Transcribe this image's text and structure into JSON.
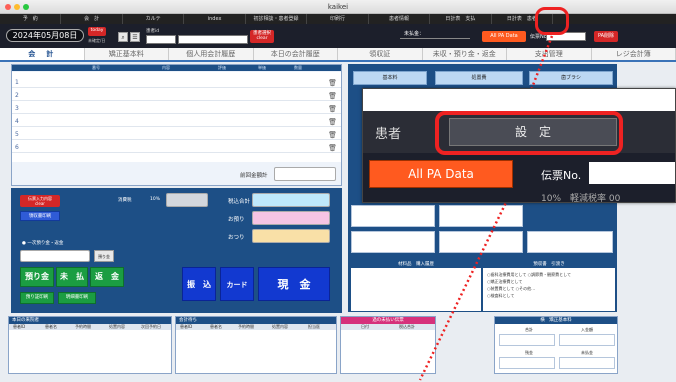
{
  "window": {
    "title": "kaikei"
  },
  "menu": [
    "予　約",
    "会　計",
    "カルテ",
    "index",
    "初診相談・患者登録",
    "印刷行",
    "患者情報",
    "日計表　支払",
    "日計表　患者",
    "",
    ""
  ],
  "toolbar": {
    "date": "2024年05月08日",
    "today_btn": "today",
    "today_sub": "未確定/日",
    "patient_id_label": "患者id",
    "patient_select_btn": "患者選択\nclear",
    "unpaid_label": "未払金：",
    "all_pa_btn": "All PA Data",
    "denpyo_label": "伝票No.",
    "print_btn": "PA削除"
  },
  "tabs": [
    "会　計",
    "矯正基本料",
    "個人用会計履歴",
    "本日の会計履歴",
    "領収証",
    "未収・預り金・返金",
    "支出管理",
    "レジ会計簿"
  ],
  "table_headers": [
    "番号",
    "内容",
    "評価",
    "単価",
    "数量"
  ],
  "line_numbers": [
    "1",
    "2",
    "3",
    "4",
    "5",
    "6"
  ],
  "unpaid_total_label": "前回金額計",
  "buttons": {
    "kakutei": "伝票入力内容\nclear",
    "ryoshu_print": "領収書印刷",
    "ikkai": "一次預り金・返金",
    "azukari_btn": "預り金",
    "azukari": "預り金",
    "mibarai": "未　払",
    "henkin": "返　金",
    "azukari_print": "預り証印刷",
    "kaikei_print": "明細書印刷",
    "furikomi": "振　込",
    "card": "カード",
    "genkin": "現　金"
  },
  "fields": {
    "tax_label": "消費税",
    "tax_rate": "10%",
    "total_label": "税込合計",
    "deposit_label": "お預り",
    "change_label": "おつり"
  },
  "right_top_tabs": [
    "基本料",
    "処置費",
    "歯ブラシ"
  ],
  "history_title": "材料品　購入履歴",
  "deposit_title": "預収書　引渡き",
  "deposit_options": [
    "歯科治療費用として",
    "調節費・観察費として",
    "矯正治療費として",
    "装置費として",
    "その他...",
    "検査料として"
  ],
  "bottom_panels": {
    "today_patients": {
      "title": "本日の来院者",
      "cols": [
        "患者ID",
        "患者名",
        "予約時間",
        "処置内容",
        "次回予約日"
      ]
    },
    "kaikei_wait": {
      "title": "会計待ち",
      "cols": [
        "患者ID",
        "患者名",
        "予約時間",
        "処置内容",
        "担当医"
      ]
    },
    "unpaid_slips": {
      "title": "過の未払い伝票",
      "cols": [
        "日付",
        "税込合計"
      ]
    },
    "kihon_ryo": {
      "title": "横　矯正基本料",
      "cols": [
        "合計",
        "入金額",
        "残金",
        "未払金"
      ]
    }
  },
  "zoom": {
    "patient_label": "患者",
    "setting_label": "設　定",
    "all_pa": "All PA Data",
    "denpyo": "伝票No.",
    "bottom_text": "10%　軽減税率 00"
  },
  "colors": {
    "accent": "#1d4f86",
    "red": "#d42727",
    "green": "#1b9d42",
    "blue": "#1239d0",
    "orange": "#ff5a1f"
  }
}
